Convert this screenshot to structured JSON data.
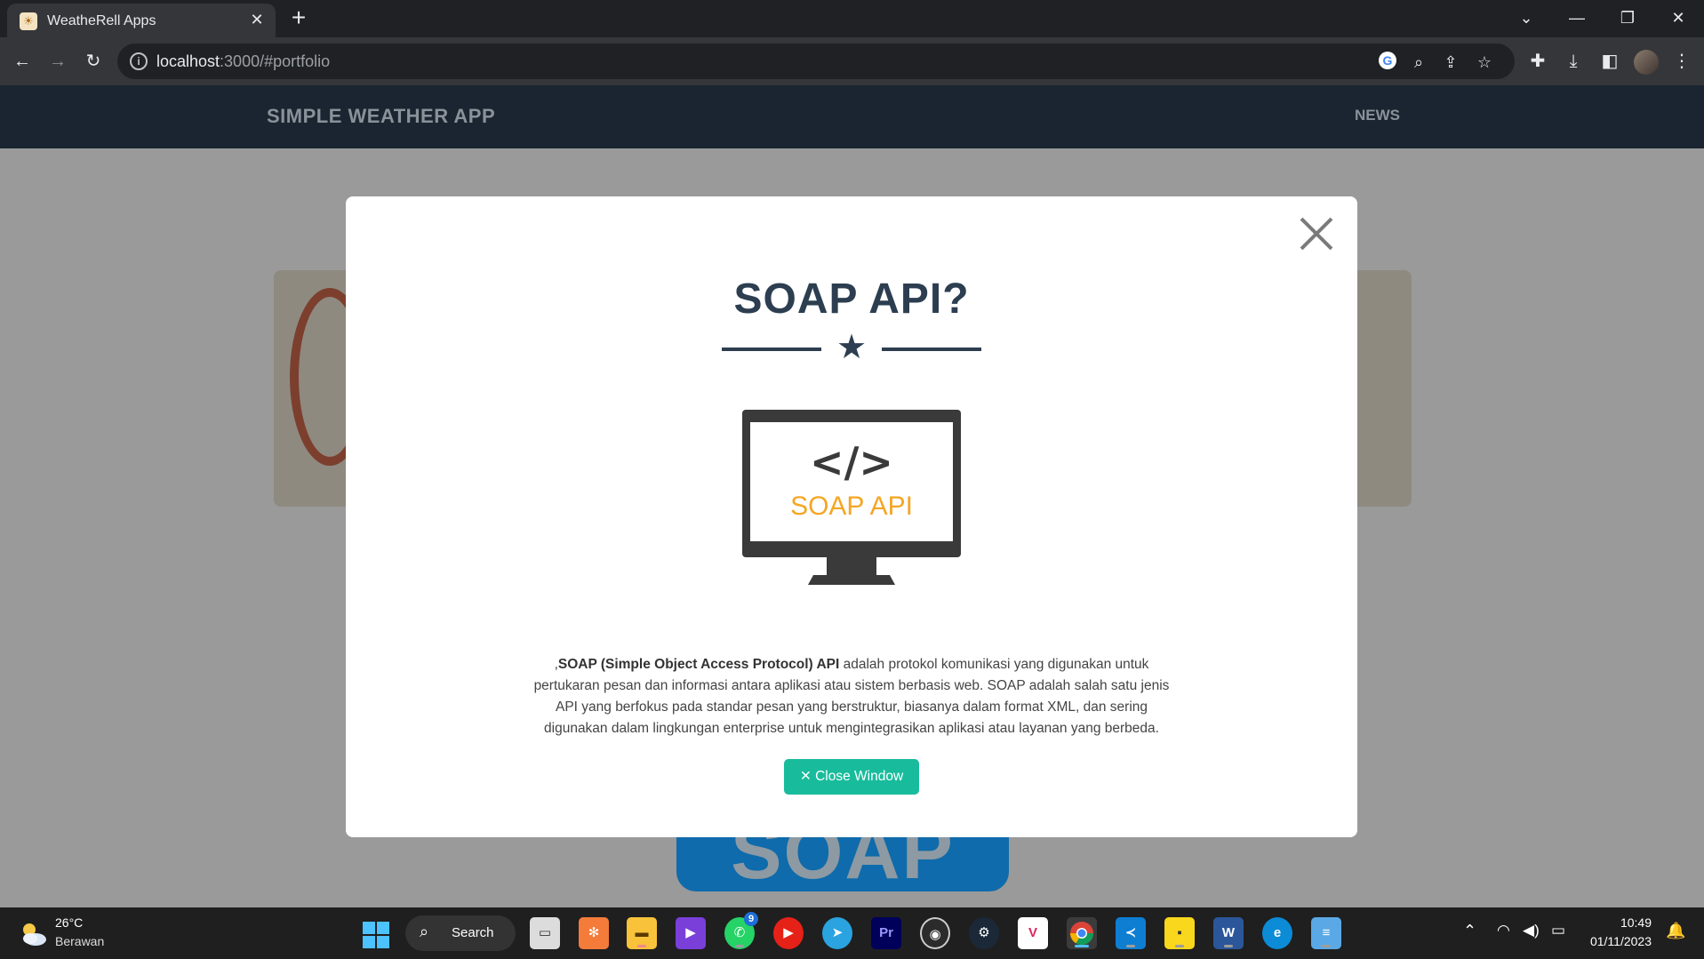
{
  "browser": {
    "tab_title": "WeatheRell Apps",
    "url_host": "localhost",
    "url_rest": ":3000/#portfolio"
  },
  "site": {
    "brand": "SIMPLE WEATHER APP",
    "nav_news": "NEWS",
    "background_badge": "SOAP"
  },
  "modal": {
    "title": "SOAP API?",
    "monitor_code": "</>",
    "monitor_label": "SOAP API",
    "desc_prefix": ",",
    "desc_bold": "SOAP (Simple Object Access Protocol) API",
    "desc_rest": " adalah protokol komunikasi yang digunakan untuk pertukaran pesan dan informasi antara aplikasi atau sistem berbasis web. SOAP adalah salah satu jenis API yang berfokus pada standar pesan yang berstruktur, biasanya dalam format XML, dan sering digunakan dalam lingkungan enterprise untuk mengintegrasikan aplikasi atau layanan yang berbeda.",
    "close_button": "✕ Close Window"
  },
  "taskbar": {
    "weather_temp": "26°C",
    "weather_desc": "Berawan",
    "search_label": "Search",
    "whatsapp_badge": "9",
    "time": "10:49",
    "date": "01/11/2023"
  },
  "colors": {
    "accent": "#18bc9c",
    "heading": "#2c3e50",
    "soap_orange": "#f5a623"
  }
}
